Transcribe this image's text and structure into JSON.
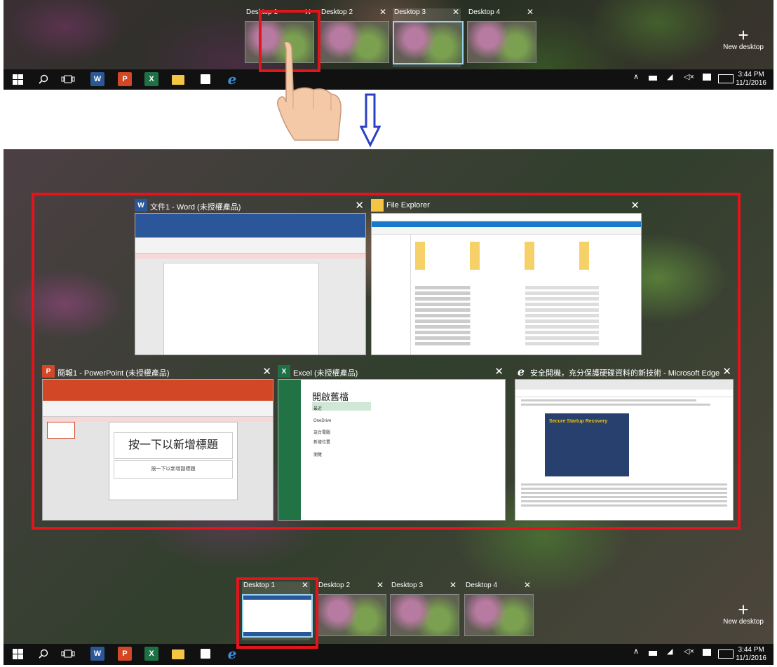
{
  "top_panel": {
    "desktops": [
      {
        "label": "Desktop 1",
        "close": "✕"
      },
      {
        "label": "Desktop 2",
        "close": "✕"
      },
      {
        "label": "Desktop 3",
        "close": "✕"
      },
      {
        "label": "Desktop 4",
        "close": "✕"
      }
    ],
    "new_desktop": "New desktop",
    "active_index": 2
  },
  "bottom_panel": {
    "desktops": [
      {
        "label": "Desktop 1",
        "close": "✕"
      },
      {
        "label": "Desktop 2",
        "close": "✕"
      },
      {
        "label": "Desktop 3",
        "close": "✕"
      },
      {
        "label": "Desktop 4",
        "close": "✕"
      }
    ],
    "new_desktop": "New desktop",
    "active_index": 0
  },
  "taskbar": {
    "time": "3:44 PM",
    "date": "11/1/2016",
    "pinned": [
      "start-icon",
      "search-icon",
      "task-view-icon",
      "word-icon",
      "powerpoint-icon",
      "excel-icon",
      "file-explorer-icon",
      "store-icon",
      "edge-icon"
    ]
  },
  "windows": {
    "word": {
      "title": "文件1 - Word (未授權產品)",
      "close": "✕",
      "icon": "W"
    },
    "explorer": {
      "title": "File Explorer",
      "close": "✕"
    },
    "powerpoint": {
      "title": "簡報1 - PowerPoint (未授權產品)",
      "close": "✕",
      "icon": "P",
      "slide_title": "按一下以新增標題",
      "slide_subtitle": "按一下以新增副標題"
    },
    "excel": {
      "title": "Excel (未授權產品)",
      "close": "✕",
      "icon": "X",
      "heading": "開啟舊檔",
      "items": [
        "最近",
        "OneDrive",
        "這台電腦",
        "新增位置",
        "瀏覽"
      ]
    },
    "edge": {
      "title": "安全開機，充分保護硬碟資料的新技術 - Microsoft Edge",
      "close": "✕",
      "image_caption": "Secure Startup Recovery"
    }
  },
  "colors": {
    "highlight": "#e3141b",
    "arrow": "#2a3fc4",
    "taskbar": "#111111"
  }
}
